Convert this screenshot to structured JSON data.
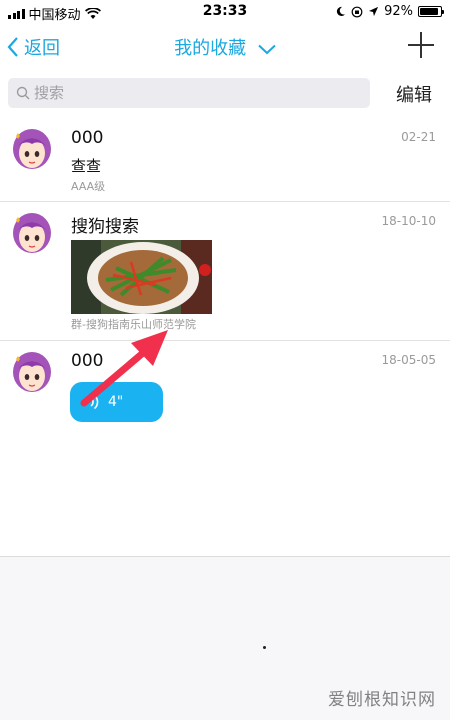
{
  "status_bar": {
    "carrier": "中国移动",
    "time": "23:33",
    "battery": "92%",
    "battery_level": 0.92
  },
  "nav": {
    "back_label": "返回",
    "title": "我的收藏",
    "add_icon": "plus-icon"
  },
  "search": {
    "placeholder": "搜索",
    "edit_label": "编辑"
  },
  "favorites": [
    {
      "title": "000",
      "date": "02-21",
      "text": "查查",
      "source": "AAA级"
    },
    {
      "title": "搜狗搜索",
      "date": "18-10-10",
      "source": "群-搜狗指南乐山师范学院"
    },
    {
      "title": "000",
      "date": "18-05-05",
      "voice_duration": "4\""
    }
  ],
  "watermark": "爱刨根知识网",
  "colors": {
    "accent": "#1ba8e0",
    "voice_bubble": "#1ab2f0",
    "arrow": "#f0304c"
  }
}
